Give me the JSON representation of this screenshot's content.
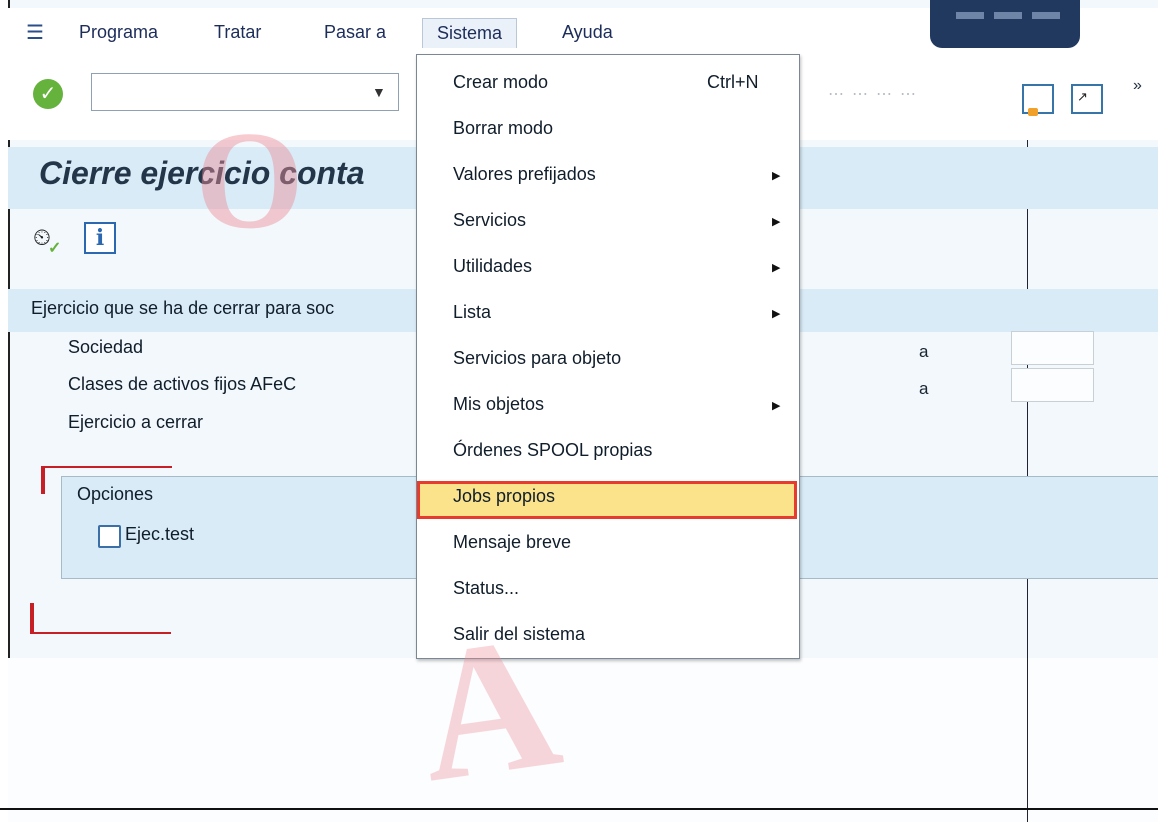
{
  "menubar": {
    "items": [
      "Programa",
      "Tratar",
      "Pasar a",
      "Sistema",
      "Ayuda"
    ]
  },
  "header": {
    "title": "Cierre ejercicio conta"
  },
  "section": {
    "title": "Ejercicio que se ha de cerrar para soc"
  },
  "fields": [
    {
      "label": "Sociedad",
      "to": "a"
    },
    {
      "label": "Clases de activos fijos AFeC",
      "to": "a"
    },
    {
      "label": "Ejercicio a cerrar"
    }
  ],
  "options": {
    "title": "Opciones",
    "checkbox": "Ejec.test"
  },
  "dropdown": {
    "items": [
      {
        "label": "Crear modo",
        "shortcut": "Ctrl+N"
      },
      {
        "label": "Borrar modo"
      },
      {
        "label": "Valores prefijados"
      },
      {
        "label": "Servicios"
      },
      {
        "label": "Utilidades"
      },
      {
        "label": "Lista"
      },
      {
        "label": "Servicios para objeto"
      },
      {
        "label": "Mis objetos"
      },
      {
        "label": "Órdenes SPOOL propias"
      },
      {
        "label": "Jobs propios"
      },
      {
        "label": "Mensaje breve"
      },
      {
        "label": "Status..."
      },
      {
        "label": "Salir del sistema"
      }
    ]
  },
  "colors": {
    "highlight": "#fae38b",
    "selected_border": "#e73b2e"
  }
}
